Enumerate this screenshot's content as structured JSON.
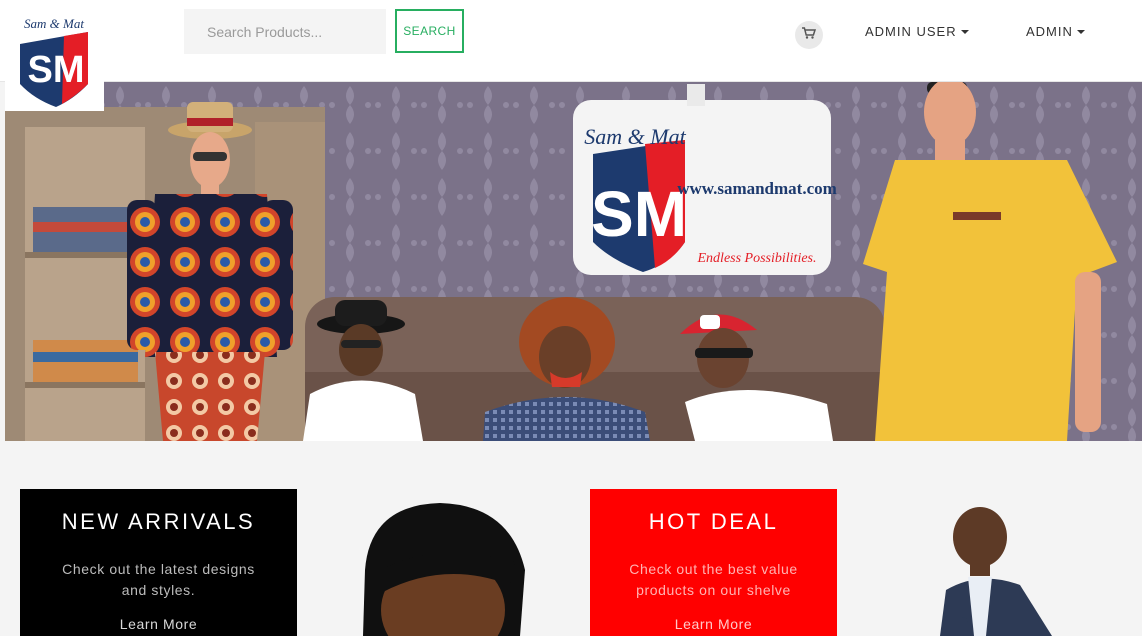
{
  "brand": {
    "logo_script": "Sam & Mat",
    "logo_letters": "SM",
    "banner_url": "www.samandmat.com",
    "banner_tagline": "Endless Possibilities."
  },
  "search": {
    "placeholder": "Search Products...",
    "button_label": "SEARCH"
  },
  "nav": {
    "user_menu": "ADMIN USER",
    "admin_menu": "ADMIN"
  },
  "cards": [
    {
      "title": "NEW ARRIVALS",
      "text": "Check out the latest designs and styles.",
      "link": "Learn More"
    },
    {
      "title": "HOT DEAL",
      "text": "Check out the best value products on our shelve",
      "link": "Learn More"
    }
  ],
  "colors": {
    "accent_green": "#27ae60",
    "brand_red": "#e41e26",
    "brand_navy": "#1d3a6e",
    "hot_deal": "#ff0000"
  },
  "icons": {
    "cart": "shopping-cart-icon"
  }
}
